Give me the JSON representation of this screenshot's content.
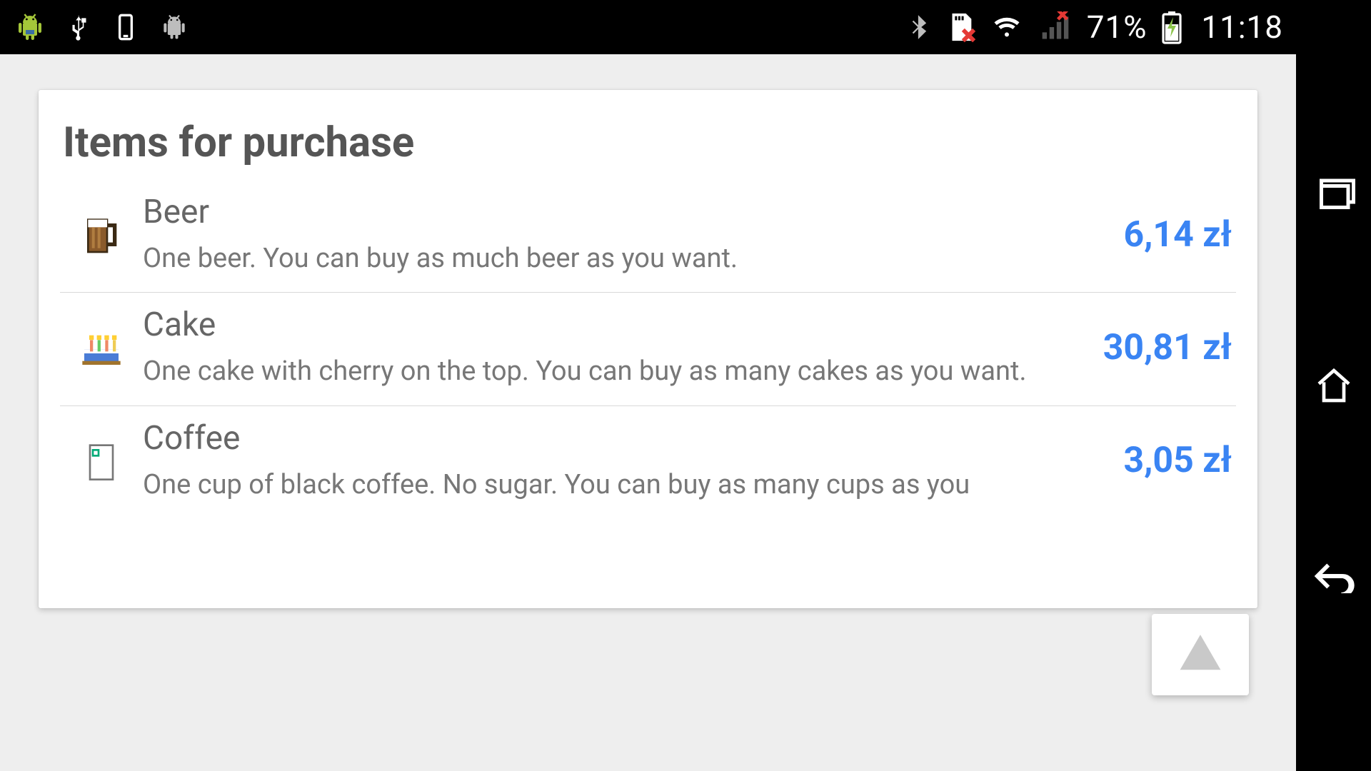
{
  "status": {
    "battery": "71%",
    "time": "11:18"
  },
  "page": {
    "title": "Items for purchase"
  },
  "items": [
    {
      "icon": "beer",
      "title": "Beer",
      "desc": "One beer. You can buy as much beer as you want.",
      "price": "6,14 zł"
    },
    {
      "icon": "cake",
      "title": "Cake",
      "desc": "One cake with cherry on the top. You can buy as many cakes as you want.",
      "price": "30,81 zł"
    },
    {
      "icon": "coffee",
      "title": "Coffee",
      "desc": "One cup of black coffee. No sugar. You can buy as many cups as you",
      "price": "3,05 zł"
    }
  ]
}
